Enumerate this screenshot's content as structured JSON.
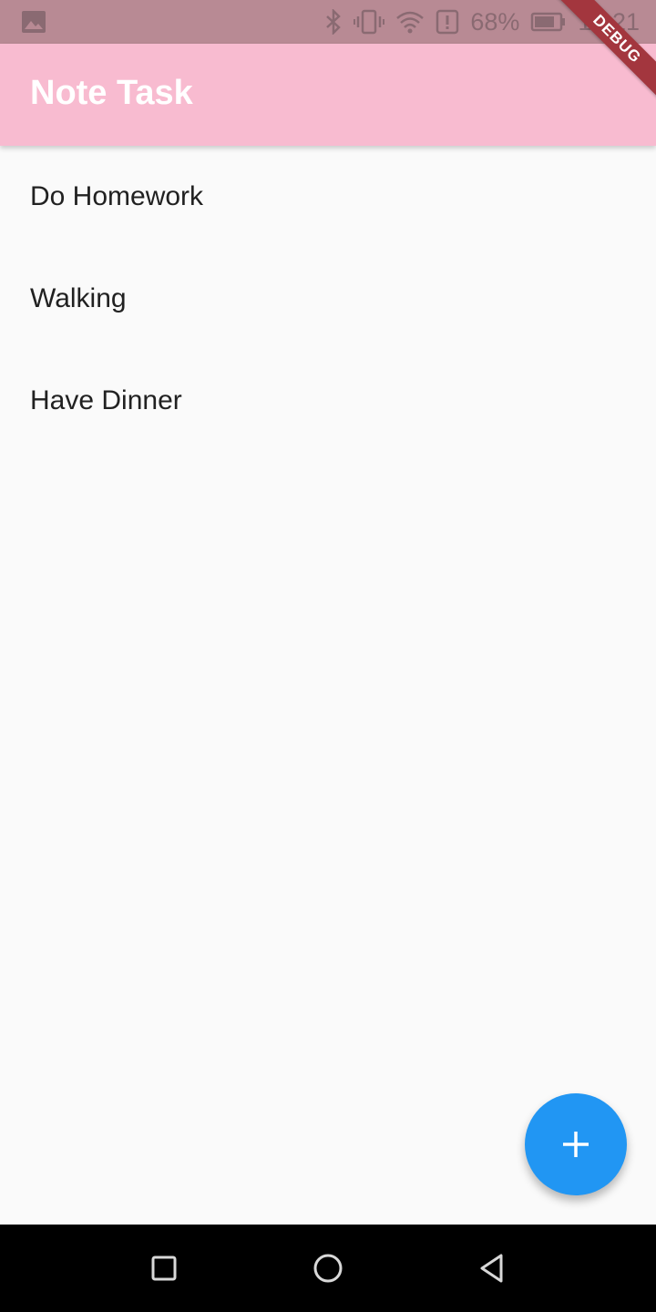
{
  "status_bar": {
    "battery_percent": "68%",
    "time": "12:21",
    "icons": [
      "gallery-icon",
      "bluetooth-icon",
      "vibrate-icon",
      "wifi-icon",
      "alert-icon",
      "battery-icon"
    ]
  },
  "debug_banner": "DEBUG",
  "app_bar": {
    "title": "Note Task",
    "color": "#f8bbd0"
  },
  "tasks": [
    {
      "label": "Do Homework"
    },
    {
      "label": "Walking"
    },
    {
      "label": "Have Dinner"
    }
  ],
  "fab": {
    "icon": "plus-icon",
    "color": "#2196f3"
  },
  "nav_bar": {
    "buttons": [
      "recents-icon",
      "home-icon",
      "back-icon"
    ]
  }
}
